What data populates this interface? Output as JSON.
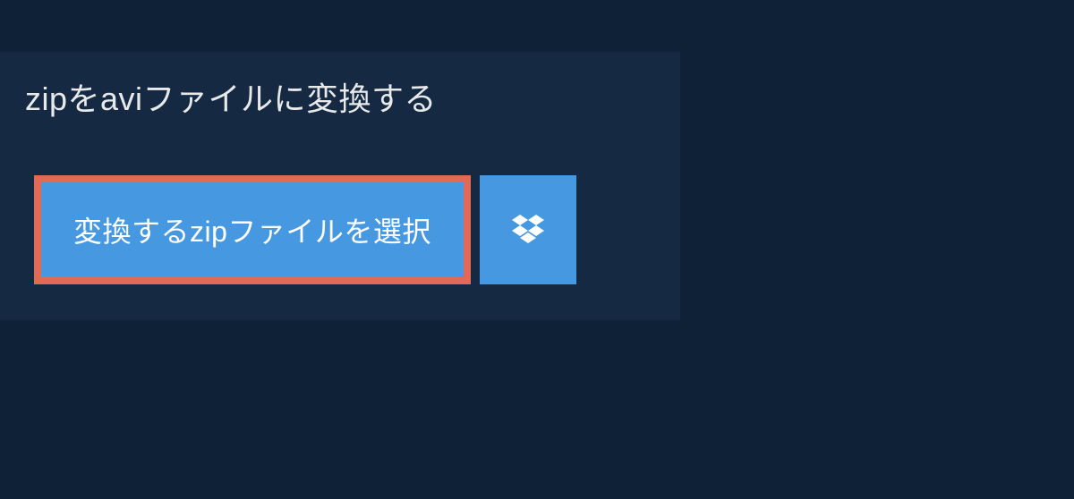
{
  "header": {
    "title": "zipをaviファイルに変換する"
  },
  "actions": {
    "select_file_label": "変換するzipファイルを選択"
  },
  "colors": {
    "background": "#0f2136",
    "panel": "#152a42",
    "button": "#4699e0",
    "highlight_border": "#e16a57",
    "text": "#e8e9ea"
  }
}
